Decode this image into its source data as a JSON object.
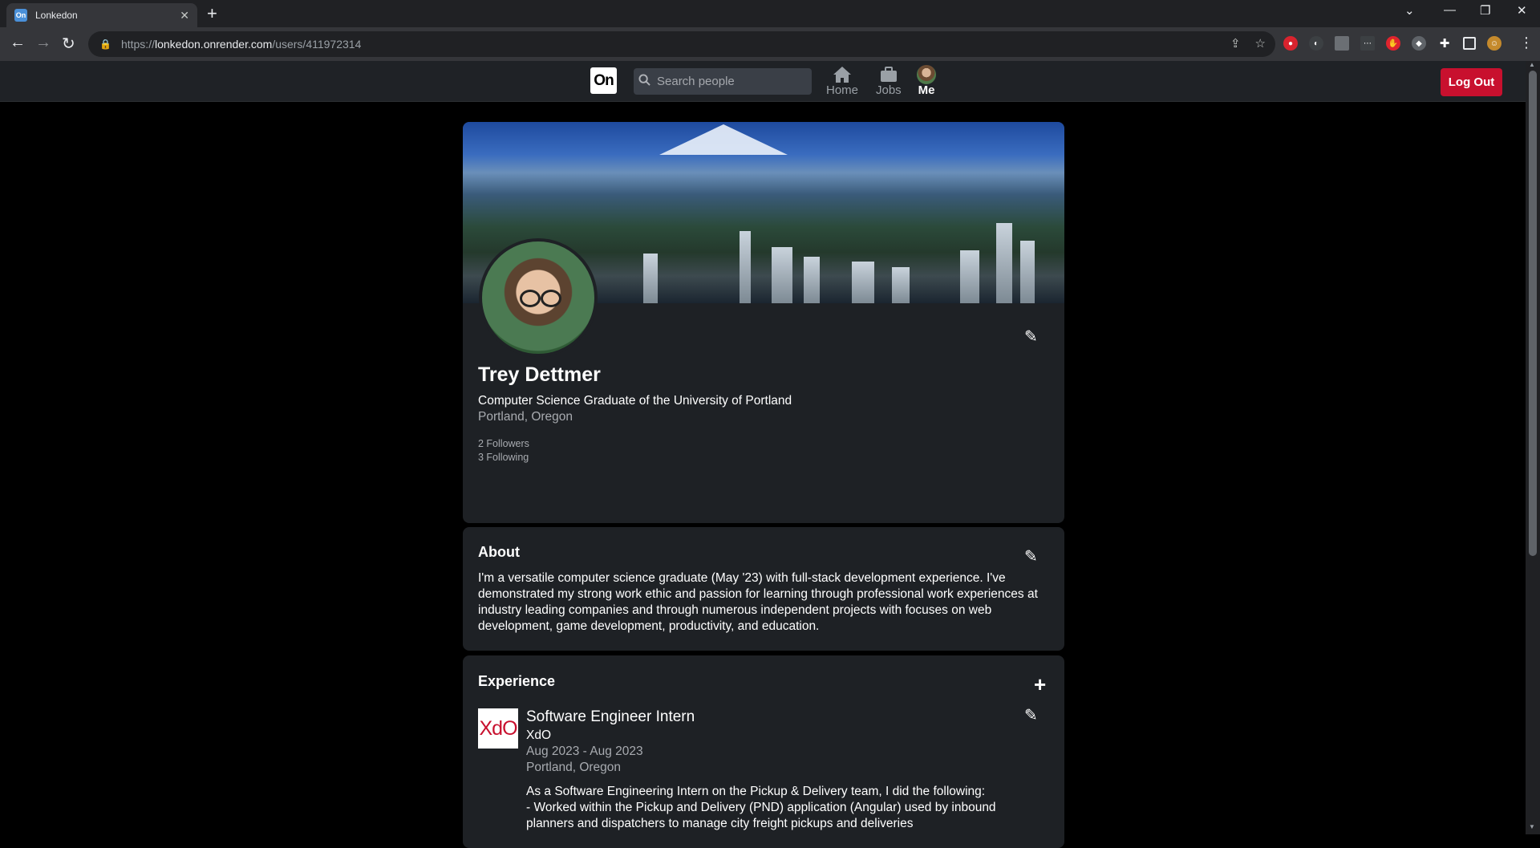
{
  "browser": {
    "tab_title": "Lonkedon",
    "tab_favicon_text": "On",
    "url_scheme": "https://",
    "url_host": "lonkedon.onrender.com",
    "url_path": "/users/411972314"
  },
  "appbar": {
    "logo_text": "On",
    "search_placeholder": "Search people",
    "nav": [
      {
        "label": "Home",
        "icon": "home-icon",
        "active": false
      },
      {
        "label": "Jobs",
        "icon": "briefcase-icon",
        "active": false
      },
      {
        "label": "Me",
        "icon": "avatar",
        "active": true
      }
    ],
    "logout_label": "Log Out",
    "logout_color": "#c8102e"
  },
  "profile": {
    "name": "Trey Dettmer",
    "headline": "Computer Science Graduate of the University of Portland",
    "location": "Portland, Oregon",
    "followers": "2 Followers",
    "following": "3 Following"
  },
  "about": {
    "heading": "About",
    "text": "I'm a versatile computer science graduate (May '23) with full-stack development experience. I've demonstrated my strong work ethic and passion for learning through professional work experiences at industry leading companies and through numerous independent projects with focuses on web development, game development, productivity, and education."
  },
  "experience": {
    "heading": "Experience",
    "items": [
      {
        "logo_text": "XdO",
        "title": "Software Engineer Intern",
        "company": "XdO",
        "dates": "Aug 2023 - Aug 2023",
        "location": "Portland, Oregon",
        "description_lines": [
          "As a Software Engineering Intern on the Pickup & Delivery team, I did the following:",
          "- Worked within the Pickup and Delivery (PND) application (Angular) used by inbound planners and dispatchers to manage city freight pickups and deliveries"
        ]
      }
    ]
  }
}
